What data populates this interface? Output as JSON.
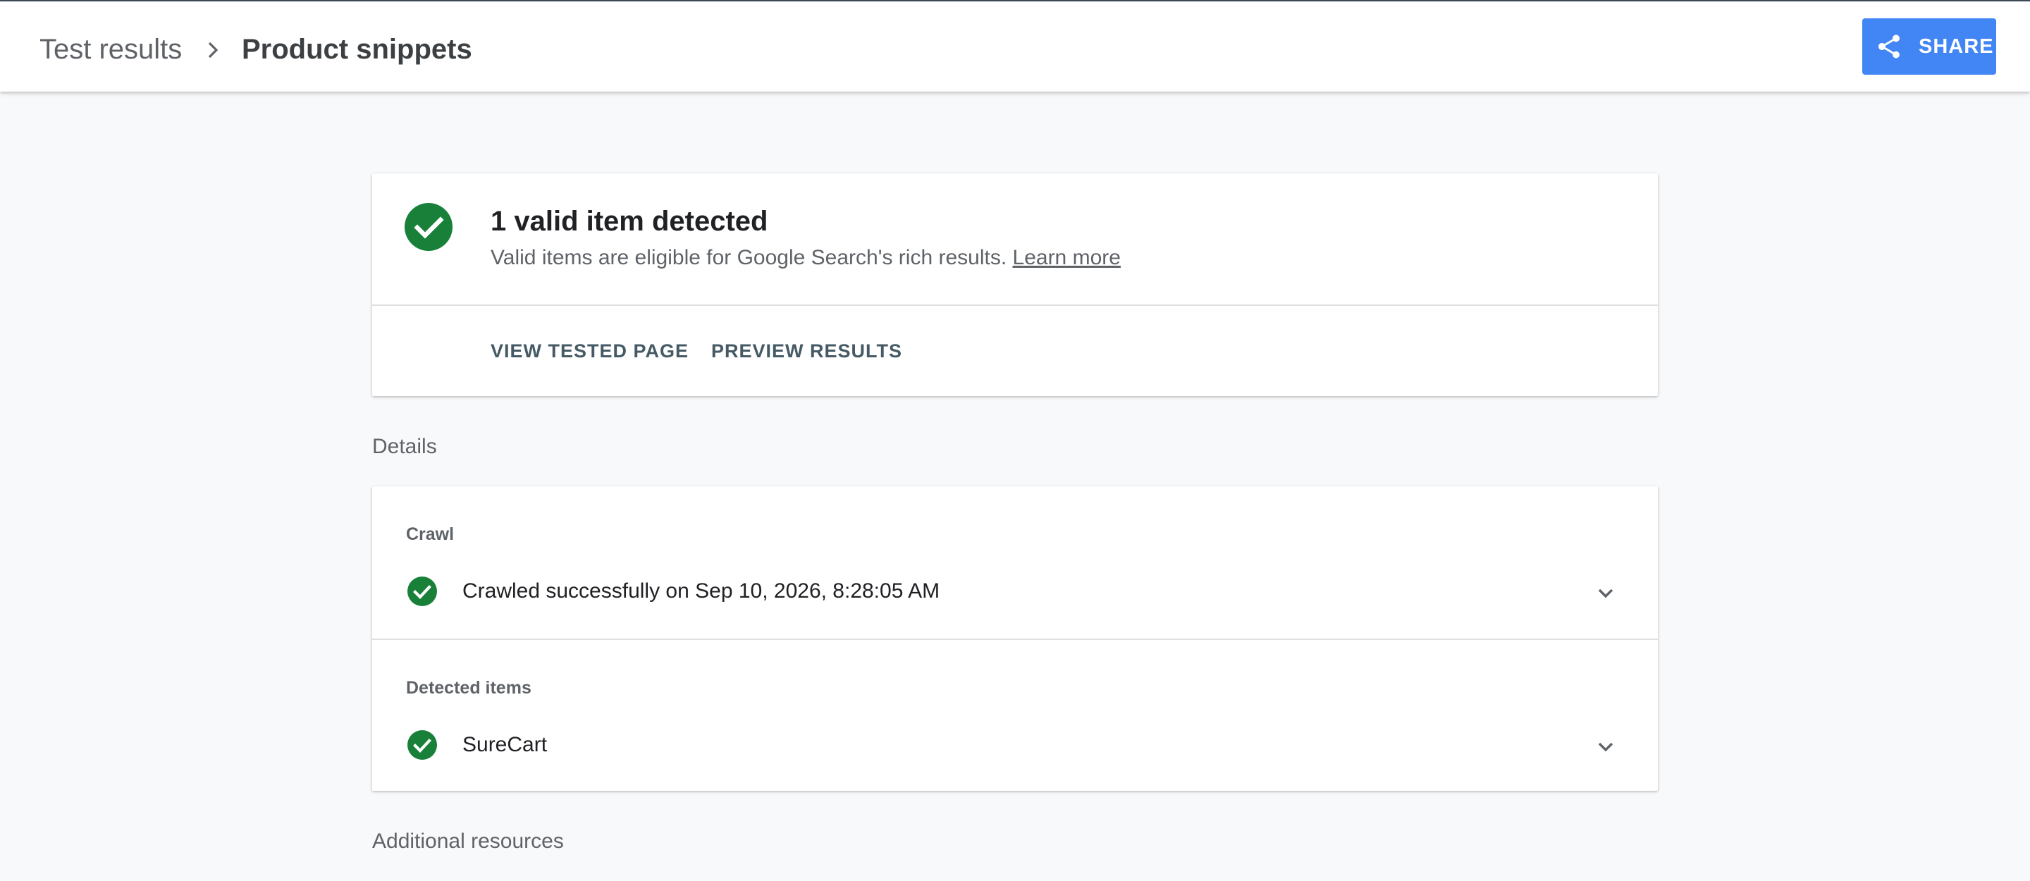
{
  "header": {
    "breadcrumb_root": "Test results",
    "breadcrumb_current": "Product snippets",
    "share_label": "SHARE"
  },
  "summary": {
    "title": "1 valid item detected",
    "subtitle": "Valid items are eligible for Google Search's rich results.",
    "learn_more": "Learn more",
    "actions": {
      "view_tested_page": "VIEW TESTED PAGE",
      "preview_results": "PREVIEW RESULTS"
    }
  },
  "details": {
    "section_label": "Details",
    "crawl": {
      "heading": "Crawl",
      "status": "Crawled successfully on Sep 10, 2026, 8:28:05 AM"
    },
    "detected_items": {
      "heading": "Detected items",
      "item": "SureCart"
    }
  },
  "additional_resources_label": "Additional resources",
  "colors": {
    "accent_blue": "#4285f4",
    "success_green": "#188038",
    "action_text": "#455a64"
  },
  "icons": {
    "breadcrumb_separator": "chevron-right-icon",
    "share": "share-icon",
    "valid": "check-circle-icon",
    "expand": "chevron-down-icon"
  }
}
